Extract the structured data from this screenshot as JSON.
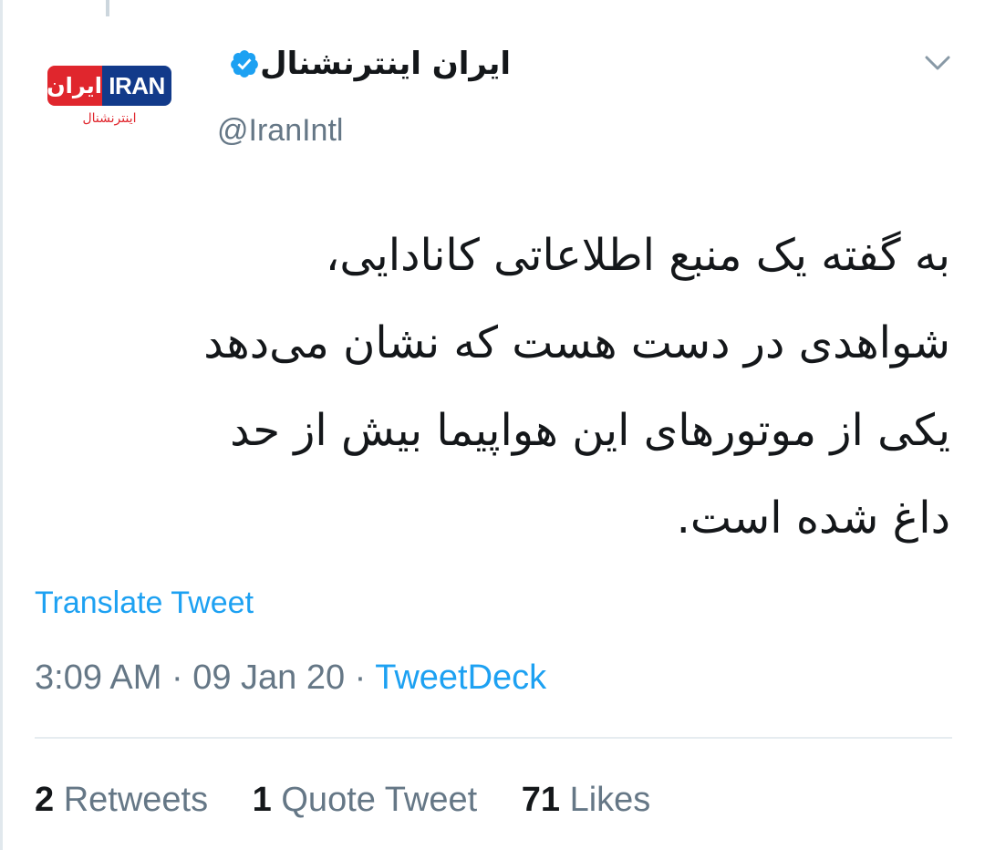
{
  "account": {
    "display_name": "ایران اینترنشنال",
    "handle": "@IranIntl",
    "verified": true,
    "avatar": {
      "logo_fa": "ایران",
      "logo_en": "IRAN",
      "logo_sub": "اینترنشنال",
      "colors": {
        "red": "#e0262d",
        "navy": "#123a8a"
      }
    }
  },
  "tweet": {
    "lines": [
      "به گفته یک منبع اطلاعاتی کانادایی،",
      "شواهدی در دست هست که نشان می‌دهد",
      "یکی از موتورهای این هواپیما بیش از حد",
      "داغ شده است."
    ],
    "translate_label": "Translate Tweet",
    "time": "3:09 AM",
    "separator": " · ",
    "date": "09 Jan 20",
    "source": "TweetDeck"
  },
  "stats": {
    "retweets": {
      "count": "2",
      "label": "Retweets"
    },
    "quotes": {
      "count": "1",
      "label": "Quote Tweet"
    },
    "likes": {
      "count": "71",
      "label": "Likes"
    }
  },
  "icons": {
    "verified": "verified-badge-icon",
    "menu": "chevron-down-icon"
  },
  "colors": {
    "accent": "#1da1f2",
    "muted": "#657786",
    "text": "#14171a"
  }
}
